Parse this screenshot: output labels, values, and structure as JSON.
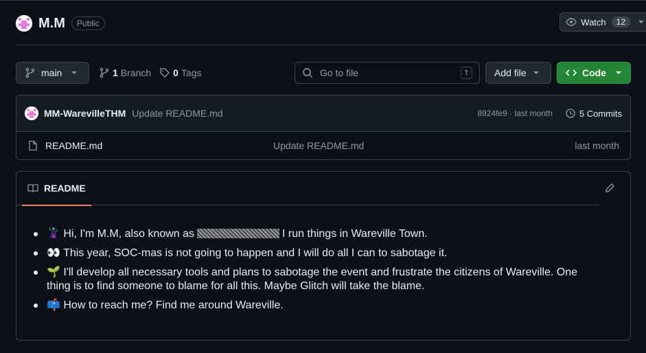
{
  "repo": {
    "name": "M.M",
    "visibility": "Public",
    "watch_label": "Watch",
    "watch_count": "12"
  },
  "toolbar": {
    "branch": "main",
    "branch_count": "1",
    "branch_label": "Branch",
    "tag_count": "0",
    "tag_label": "Tags",
    "search_placeholder": "Go to file",
    "search_key": "t",
    "add_file": "Add file",
    "code": "Code"
  },
  "latest_commit": {
    "author": "MM-WarevilleTHM",
    "message": "Update README.md",
    "sha_time": "8924fe9 · last month",
    "commits": "5 Commits"
  },
  "files": [
    {
      "name": "README.md",
      "message": "Update README.md",
      "time": "last month"
    }
  ],
  "readme": {
    "tab": "README",
    "items": [
      {
        "emoji": "🦹",
        "pre": "Hi, I'm M.M, also known as",
        "post": "I run things in Wareville Town."
      },
      {
        "emoji": "👀",
        "text": "This year, SOC-mas is not going to happen and I will do all I can to sabotage it."
      },
      {
        "emoji": "🌱",
        "text": "I'll develop all necessary tools and plans to sabotage the event and frustrate the citizens of Wareville. One thing is to find someone to blame for all this. Maybe Glitch will take the blame."
      },
      {
        "emoji": "📫",
        "text": "How to reach me? Find me around Wareville."
      }
    ]
  },
  "colors": {
    "background": "#0d1117",
    "border": "#3d444d",
    "code_button": "#238636",
    "tab_underline": "#f78166"
  }
}
